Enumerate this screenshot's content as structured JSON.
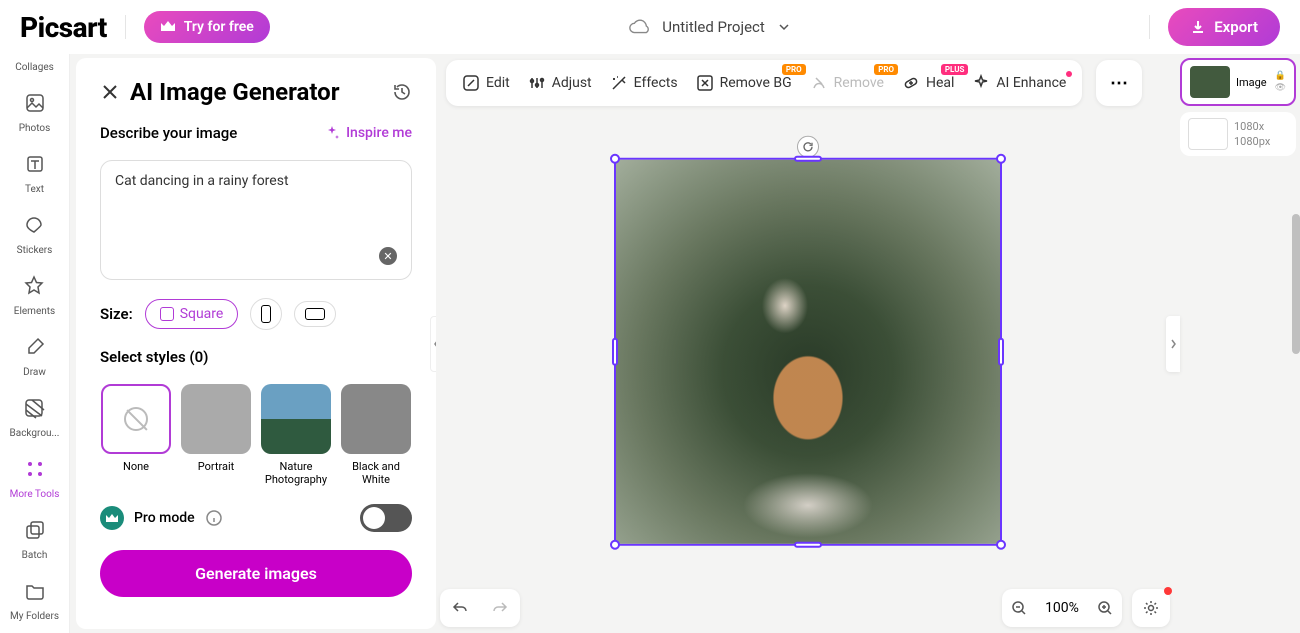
{
  "header": {
    "logo_text": "Picsart",
    "try_label": "Try for free",
    "project_name": "Untitled Project",
    "export_label": "Export"
  },
  "rail": {
    "items": [
      {
        "label": "Collages"
      },
      {
        "label": "Photos"
      },
      {
        "label": "Text"
      },
      {
        "label": "Stickers"
      },
      {
        "label": "Elements"
      },
      {
        "label": "Draw"
      },
      {
        "label": "Backgrou..."
      },
      {
        "label": "More Tools"
      },
      {
        "label": "Batch"
      },
      {
        "label": "My Folders"
      }
    ]
  },
  "panel": {
    "title": "AI Image Generator",
    "describe_label": "Describe your image",
    "inspire_label": "Inspire me",
    "prompt_value": "Cat dancing in a rainy forest",
    "size_label": "Size:",
    "size_active": "Square",
    "styles_label": "Select styles (0)",
    "style_names": [
      "None",
      "Portrait",
      "Nature Photography",
      "Black and White"
    ],
    "pro_label": "Pro mode",
    "generate_label": "Generate images"
  },
  "toolbar": {
    "edit": "Edit",
    "adjust": "Adjust",
    "effects": "Effects",
    "removebg": "Remove BG",
    "remove": "Remove",
    "heal": "Heal",
    "aienhance": "AI Enhance",
    "badges": {
      "removebg": "PRO",
      "remove": "PRO",
      "heal": "PLUS"
    }
  },
  "footer": {
    "zoom_label": "100%"
  },
  "layers": {
    "image_label": "Image",
    "dims_line1": "1080x",
    "dims_line2": "1080px"
  }
}
